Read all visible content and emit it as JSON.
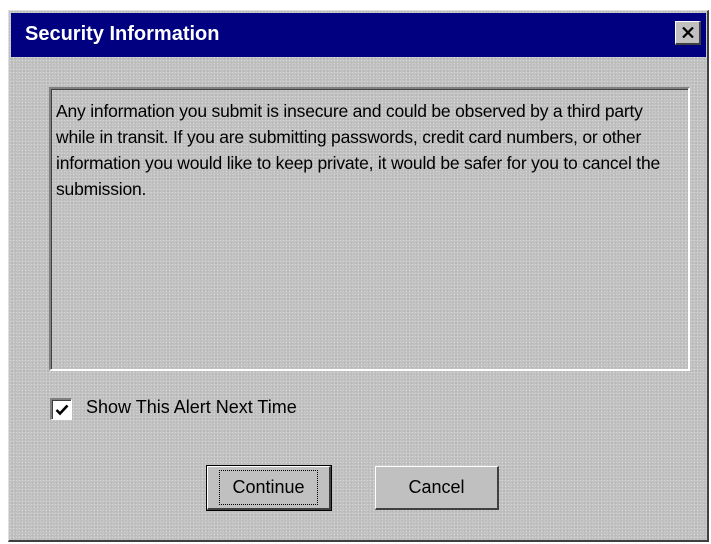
{
  "window": {
    "title": "Security Information",
    "close_icon": "close-icon"
  },
  "message": {
    "text": "Any information you submit is insecure and could be observed by a third party while in transit. If you are submitting passwords, credit card numbers, or other information you would like to keep private, it would be safer for you to cancel the submission."
  },
  "alert_checkbox": {
    "label": "Show This Alert Next Time",
    "checked": true
  },
  "buttons": {
    "continue_label": "Continue",
    "cancel_label": "Cancel"
  },
  "colors": {
    "titlebar": "#000080",
    "dialog_face": "#c0c0c0"
  }
}
